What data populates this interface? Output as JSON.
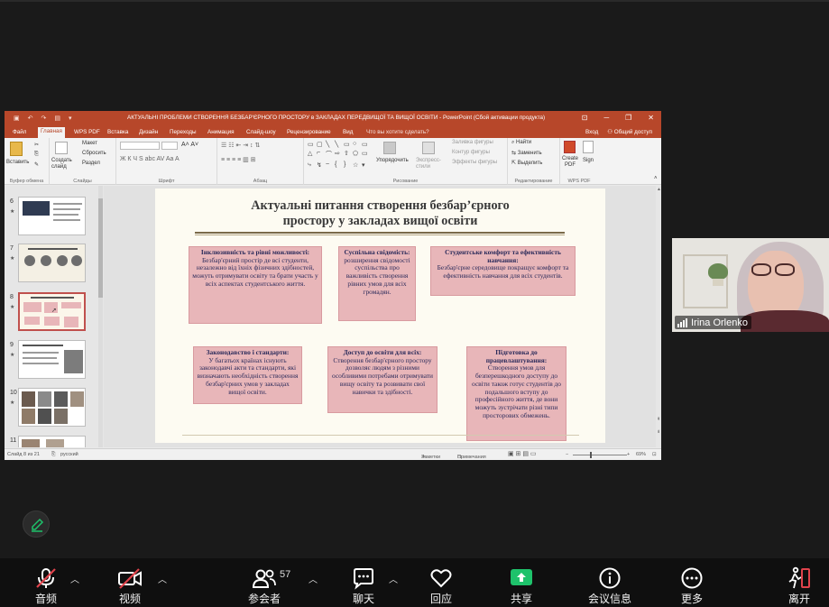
{
  "ppt": {
    "doc_title": "АКТУАЛЬНІ ПРОБЛЕМИ СТВОРЕННЯ БЕЗБАР'ЄРНОГО ПРОСТОРУ в ЗАКЛАДАХ ПЕРЕДВИЩОЇ ТА ВИЩОЇ ОСВІТИ  -  PowerPoint (Сбой активации продукта)",
    "tabs": [
      "Файл",
      "Главная",
      "WPS PDF",
      "Вставка",
      "Дизайн",
      "Переходы",
      "Анимация",
      "Слайд-шоу",
      "Рецензирование",
      "Вид",
      "Что вы хотите сделать?"
    ],
    "right_links": [
      "Вход",
      "Общий доступ"
    ],
    "ribbon": {
      "clipboard": {
        "paste": "Вставить",
        "group": "Буфер обмена"
      },
      "slides": {
        "create": "Создать слайд",
        "layout": "Макет",
        "reset": "Сбросить",
        "section": "Раздел",
        "group": "Слайды"
      },
      "font": {
        "group": "Шрифт",
        "styles": "Ж  К  Ч  S  abc  AV  Aa  A"
      },
      "paragraph": {
        "group": "Абзац"
      },
      "drawing": {
        "arrange": "Упорядочить",
        "quick_styles": "Экспресс-стили",
        "fill": "Заливка фигуры",
        "outline": "Контур фигуры",
        "effects": "Эффекты фигуры",
        "group": "Рисование"
      },
      "editing": {
        "find": "Найти",
        "replace": "Заменить",
        "select": "Выделить",
        "group": "Редактирование"
      },
      "wps": {
        "create_pdf": "Create PDF",
        "sign": "Sign",
        "group": "WPS PDF"
      }
    },
    "thumb_numbers": [
      "6",
      "7",
      "8",
      "9",
      "10",
      "11"
    ],
    "slide": {
      "title_line1": "Актуальні питання створення безбар’єрного",
      "title_line2": "простору у закладах вищої освіти",
      "boxes": [
        {
          "head": "Інклюзивність та рівні можливості:",
          "body": "Безбар'єрний простір  де всі студенти, незалежно від їхніх фізичних здібностей, можуть отримувати освіту та брати участь у всіх аспектах студентського життя."
        },
        {
          "head": "Суспільна свідомість:",
          "body": "розширення свідомості суспільства про важливість створення рівних умов для всіх громадян."
        },
        {
          "head": "Студентське комфорт та ефективність навчання:",
          "body": "Безбар'єрне середовище покращує комфорт та ефективність навчання для всіх студентів."
        },
        {
          "head": "Законодавство і стандарти:",
          "body": "У багатьох країнах існують законодавчі акти та стандарти, які визначають необхідність створення безбар'єрних умов у закладах вищої освіти."
        },
        {
          "head": "Доступ до освіти для всіх:",
          "body": "Створення безбар'єрного простору дозволяє людям з різними особливими потребами отримувати вищу освіту та розвивати свої навички та здібності."
        },
        {
          "head": "Підготовка до працевлаштування:",
          "body": "Створення умов для безперешкодного доступу до освіти також готує студентів до подальшого вступу до професійного життя, де вони можуть зустрічати різні типи просторових обмежень."
        }
      ]
    },
    "status": {
      "slide_of": "Слайд 8 из 21",
      "language": "русский",
      "notes": "Заметки",
      "comments": "Примечания",
      "zoom": "69%"
    }
  },
  "camera": {
    "name": "Irina Orlenko"
  },
  "toolbar": [
    {
      "label": "音频",
      "icon": "microphone-muted-icon",
      "caret": true
    },
    {
      "label": "视频",
      "icon": "video-off-icon",
      "caret": true
    },
    {
      "label": "参会者",
      "icon": "participants-icon",
      "caret": true,
      "count": "57"
    },
    {
      "label": "聊天",
      "icon": "chat-icon",
      "caret": true
    },
    {
      "label": "回应",
      "icon": "heart-icon",
      "caret": false
    },
    {
      "label": "共享",
      "icon": "share-screen-icon",
      "caret": false
    },
    {
      "label": "会议信息",
      "icon": "info-icon",
      "caret": false
    },
    {
      "label": "更多",
      "icon": "more-icon",
      "caret": false
    },
    {
      "label": "离开",
      "icon": "leave-icon",
      "caret": false
    }
  ],
  "colors": {
    "ppt_brand": "#b7472a",
    "share_green": "#1ec26b",
    "mute_red": "#e0434c",
    "box_fill": "#e8b6b9"
  }
}
